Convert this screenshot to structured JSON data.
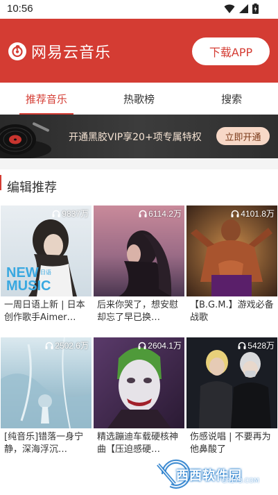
{
  "status_bar": {
    "time": "10:56",
    "icons": [
      "wifi-icon",
      "signal-icon",
      "battery-icon"
    ]
  },
  "header": {
    "app_name": "网易云音乐",
    "download_label": "下载APP",
    "brand_color": "#d43c33"
  },
  "tabs": [
    {
      "label": "推荐音乐",
      "active": true
    },
    {
      "label": "热歌榜",
      "active": false
    },
    {
      "label": "搜索",
      "active": false
    }
  ],
  "vip_banner": {
    "text": "开通黑胶VIP享20+项专属特权",
    "button_label": "立即开通"
  },
  "section": {
    "title": "编辑推荐"
  },
  "playlists": [
    {
      "count": "9837万",
      "title": "一周日语上新 | 日本创作歌手Aimer…"
    },
    {
      "count": "6114.2万",
      "title": "后来你哭了，想安慰却忘了早已换…"
    },
    {
      "count": "4101.8万",
      "title": "【B.G.M.】游戏必备战歌"
    },
    {
      "count": "2502.6万",
      "title": "[纯音乐]错落一身宁静，深海浮沉…"
    },
    {
      "count": "2604.1万",
      "title": "精选蹦迪车载硬核神曲【压迫感硬…"
    },
    {
      "count": "5428万",
      "title": "伤感说唱 | 不要再为他鼻酸了"
    }
  ],
  "cover_text": {
    "line1": "NEW",
    "badge": "日语",
    "line2": "MUSIC"
  },
  "watermark": {
    "text": "西西软件园",
    "sub": "CR173.COM"
  }
}
